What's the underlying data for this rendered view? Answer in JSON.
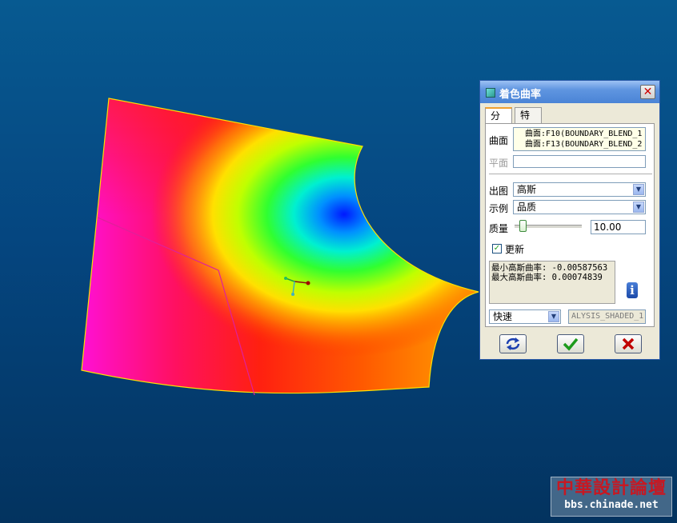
{
  "dialog": {
    "title": "着色曲率",
    "tabs": [
      "分析",
      "特征"
    ],
    "surface_label": "曲面",
    "surfaces": [
      "曲面:F10(BOUNDARY_BLEND_1",
      "曲面:F13(BOUNDARY_BLEND_2"
    ],
    "plane_label": "平面",
    "plane_value": "",
    "output_label": "出图",
    "output_value": "高斯",
    "display_label": "示例",
    "display_value": "品质",
    "quality_label": "质量",
    "quality_value": "10.00",
    "quality_level": 0.05,
    "update_label": "更新",
    "update_checked": true,
    "result_min": "最小高斯曲率: -0.00587563",
    "result_max": "最大高斯曲率: 0.00074839",
    "mode_value": "快速",
    "feature_name": "ALYSIS_SHADED_1"
  },
  "watermark": {
    "title": "中華設計論壇",
    "url": "bbs.chinade.net"
  },
  "colors": {
    "background_top": "#075a91",
    "background_bottom": "#03335f",
    "title_bar": "#5f95e0",
    "ok_green": "#1c9a1c",
    "cancel_red": "#c00000"
  }
}
